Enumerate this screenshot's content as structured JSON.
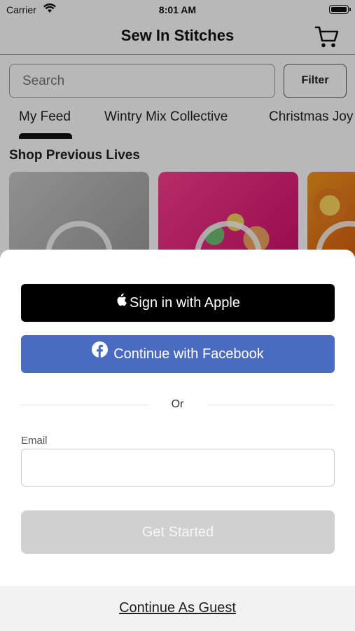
{
  "status_bar": {
    "carrier": "Carrier",
    "time": "8:01 AM"
  },
  "nav": {
    "title": "Sew In Stitches"
  },
  "search": {
    "placeholder": "Search",
    "filter_label": "Filter"
  },
  "tabs": [
    {
      "label": "My Feed",
      "active": true
    },
    {
      "label": "Wintry Mix Collective",
      "active": false
    },
    {
      "label": "Christmas Joy",
      "active": false
    }
  ],
  "section": {
    "title": "Shop Previous Lives"
  },
  "login_sheet": {
    "apple_label": "Sign in with Apple",
    "facebook_label": "Continue with Facebook",
    "divider_text": "Or",
    "email_label": "Email",
    "email_value": "",
    "get_started_label": "Get Started",
    "guest_label": "Continue As Guest"
  },
  "colors": {
    "apple_button": "#000000",
    "facebook_button": "#4a6cc0",
    "get_started_disabled": "#d0d0d0"
  }
}
